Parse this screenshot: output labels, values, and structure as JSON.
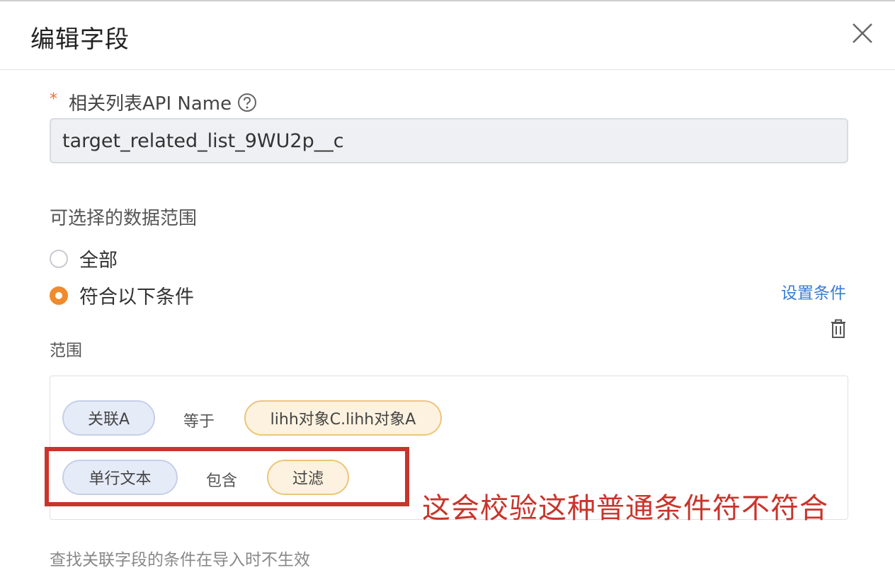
{
  "dialog": {
    "title": "编辑字段"
  },
  "api_name_field": {
    "required_marker": "*",
    "label": "相关列表API Name",
    "value": "target_related_list_9WU2p__c"
  },
  "data_range": {
    "label": "可选择的数据范围",
    "options": [
      {
        "label": "全部",
        "selected": false
      },
      {
        "label": "符合以下条件",
        "selected": true
      }
    ],
    "set_condition_link": "设置条件"
  },
  "scope": {
    "label": "范围",
    "conditions": [
      {
        "field": "关联A",
        "operator": "等于",
        "value": "lihh对象C.lihh对象A"
      },
      {
        "field": "单行文本",
        "operator": "包含",
        "value": "过滤"
      }
    ]
  },
  "annotation": {
    "text": "这会校验这种普通条件符不符合",
    "color": "#c9342b"
  },
  "footnote": "查找关联字段的条件在导入时不生效",
  "colors": {
    "accent_orange": "#f08a2c",
    "link_blue": "#3a7bd5",
    "required_red": "#f26b2a"
  }
}
